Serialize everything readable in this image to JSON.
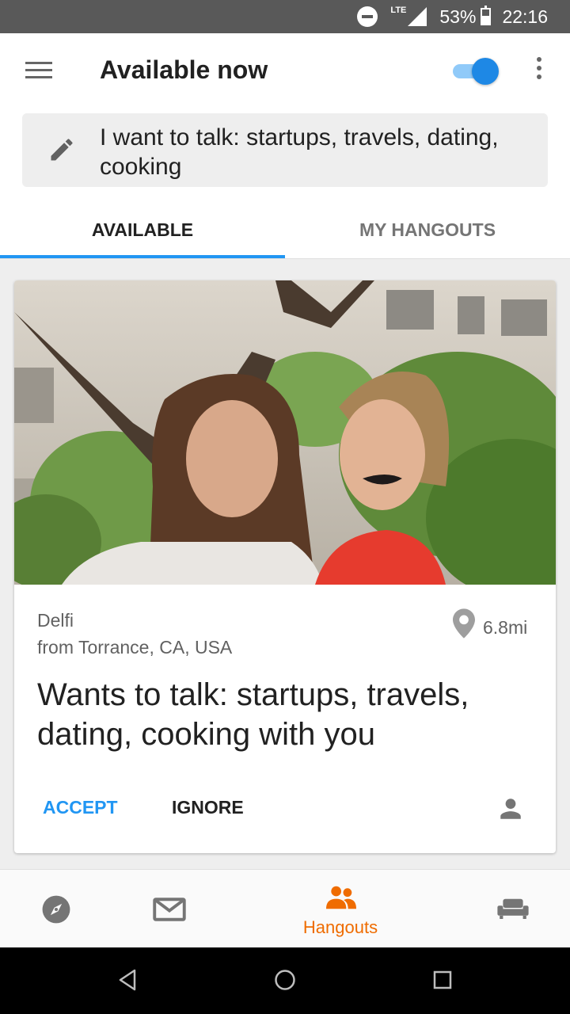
{
  "status_bar": {
    "network": "LTE",
    "battery": "53%",
    "time": "22:16",
    "icons": [
      "do-not-disturb-icon",
      "signal-icon",
      "battery-icon"
    ]
  },
  "app_bar": {
    "title": "Available now",
    "toggle_on": true,
    "icons": [
      "menu-icon",
      "more-vert-icon"
    ]
  },
  "topic": {
    "text": "I want to talk: startups, travels, dating, cooking",
    "icon": "pencil-icon"
  },
  "tabs": [
    {
      "label": "AVAILABLE",
      "active": true
    },
    {
      "label": "MY HANGOUTS",
      "active": false
    }
  ],
  "card": {
    "name": "Delfi",
    "from": "from Torrance, CA, USA",
    "distance": "6.8mi",
    "wants": "Wants to talk: startups, travels, dating, cooking with you",
    "accept_label": "ACCEPT",
    "ignore_label": "IGNORE",
    "icons": [
      "location-pin-icon",
      "person-icon"
    ]
  },
  "bottom_nav": {
    "items": [
      {
        "icon": "compass-icon",
        "label": ""
      },
      {
        "icon": "mail-icon",
        "label": ""
      },
      {
        "icon": "people-icon",
        "label": "Hangouts",
        "active": true
      },
      {
        "icon": "couch-icon",
        "label": ""
      }
    ]
  },
  "colors": {
    "accent_blue": "#2196f3",
    "active_orange": "#ef6c00",
    "status_bar": "#595959"
  }
}
